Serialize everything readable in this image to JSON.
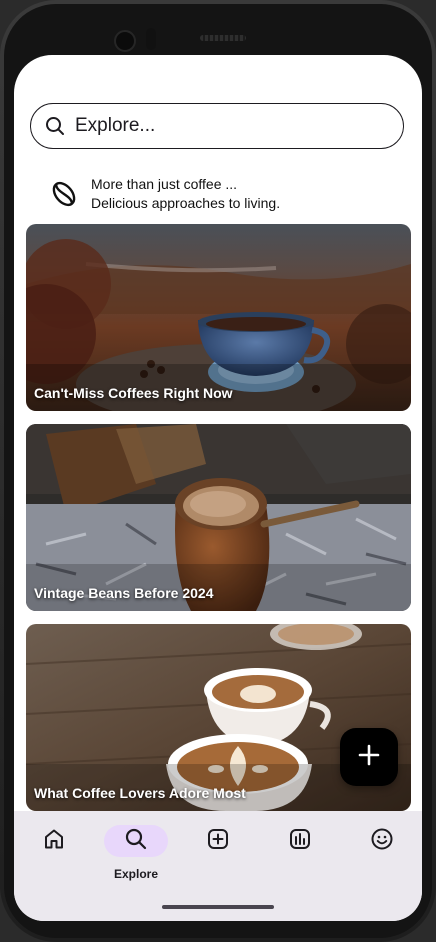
{
  "search": {
    "placeholder": "Explore..."
  },
  "tagline": {
    "line1": "More than just coffee ...",
    "line2": "Delicious approaches to living."
  },
  "cards": [
    {
      "title": "Can't-Miss Coffees Right Now"
    },
    {
      "title": "Vintage Beans Before 2024"
    },
    {
      "title": "What Coffee Lovers Adore Most"
    }
  ],
  "fab": {
    "icon": "plus-icon"
  },
  "nav": {
    "items": [
      {
        "icon": "home-icon",
        "label": ""
      },
      {
        "icon": "search-icon",
        "label": "Explore",
        "active": true
      },
      {
        "icon": "add-box-icon",
        "label": ""
      },
      {
        "icon": "bar-chart-icon",
        "label": ""
      },
      {
        "icon": "smiley-icon",
        "label": ""
      }
    ]
  },
  "colors": {
    "nav_background": "#ebe8ee",
    "active_pill": "#e8d7fb",
    "fab_background": "#000000"
  }
}
